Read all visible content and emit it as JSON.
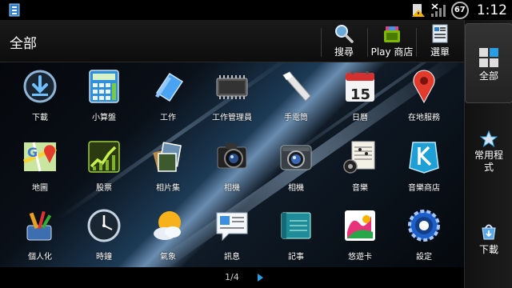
{
  "status": {
    "battery": "67",
    "time": "1:12"
  },
  "header": {
    "title": "全部",
    "actions": [
      {
        "label": "搜尋",
        "icon": "search-icon"
      },
      {
        "label": "Play 商店",
        "icon": "play-store-icon"
      },
      {
        "label": "選單",
        "icon": "menu-icon"
      }
    ]
  },
  "apps": [
    {
      "label": "下載",
      "icon": "download-icon"
    },
    {
      "label": "小算盤",
      "icon": "calculator-icon"
    },
    {
      "label": "工作",
      "icon": "tasks-icon"
    },
    {
      "label": "工作管理員",
      "icon": "task-manager-icon"
    },
    {
      "label": "手電筒",
      "icon": "flashlight-icon"
    },
    {
      "label": "日曆",
      "icon": "calendar-icon",
      "badge": "15"
    },
    {
      "label": "在地服務",
      "icon": "location-pin-icon"
    },
    {
      "label": "地圖",
      "icon": "maps-icon"
    },
    {
      "label": "股票",
      "icon": "stocks-icon"
    },
    {
      "label": "相片集",
      "icon": "gallery-icon"
    },
    {
      "label": "相機",
      "icon": "camera-icon"
    },
    {
      "label": "相機",
      "icon": "camera-alt-icon"
    },
    {
      "label": "音樂",
      "icon": "music-icon"
    },
    {
      "label": "音樂商店",
      "icon": "music-store-icon"
    },
    {
      "label": "個人化",
      "icon": "personalize-icon"
    },
    {
      "label": "時鐘",
      "icon": "clock-icon"
    },
    {
      "label": "氣象",
      "icon": "weather-icon"
    },
    {
      "label": "訊息",
      "icon": "messages-icon"
    },
    {
      "label": "記事",
      "icon": "notes-icon"
    },
    {
      "label": "悠遊卡",
      "icon": "easycard-icon"
    },
    {
      "label": "設定",
      "icon": "settings-icon"
    }
  ],
  "pager": {
    "indicator": "1/4"
  },
  "sidebar": {
    "tabs": [
      {
        "label": "全部",
        "icon": "all-apps-icon",
        "active": true
      },
      {
        "label_line1": "常用程",
        "label_line2": "式",
        "icon": "star-icon"
      },
      {
        "label": "下載",
        "icon": "download-bag-icon"
      }
    ]
  },
  "colors": {
    "accent": "#2a9de3",
    "background": "#000000"
  }
}
